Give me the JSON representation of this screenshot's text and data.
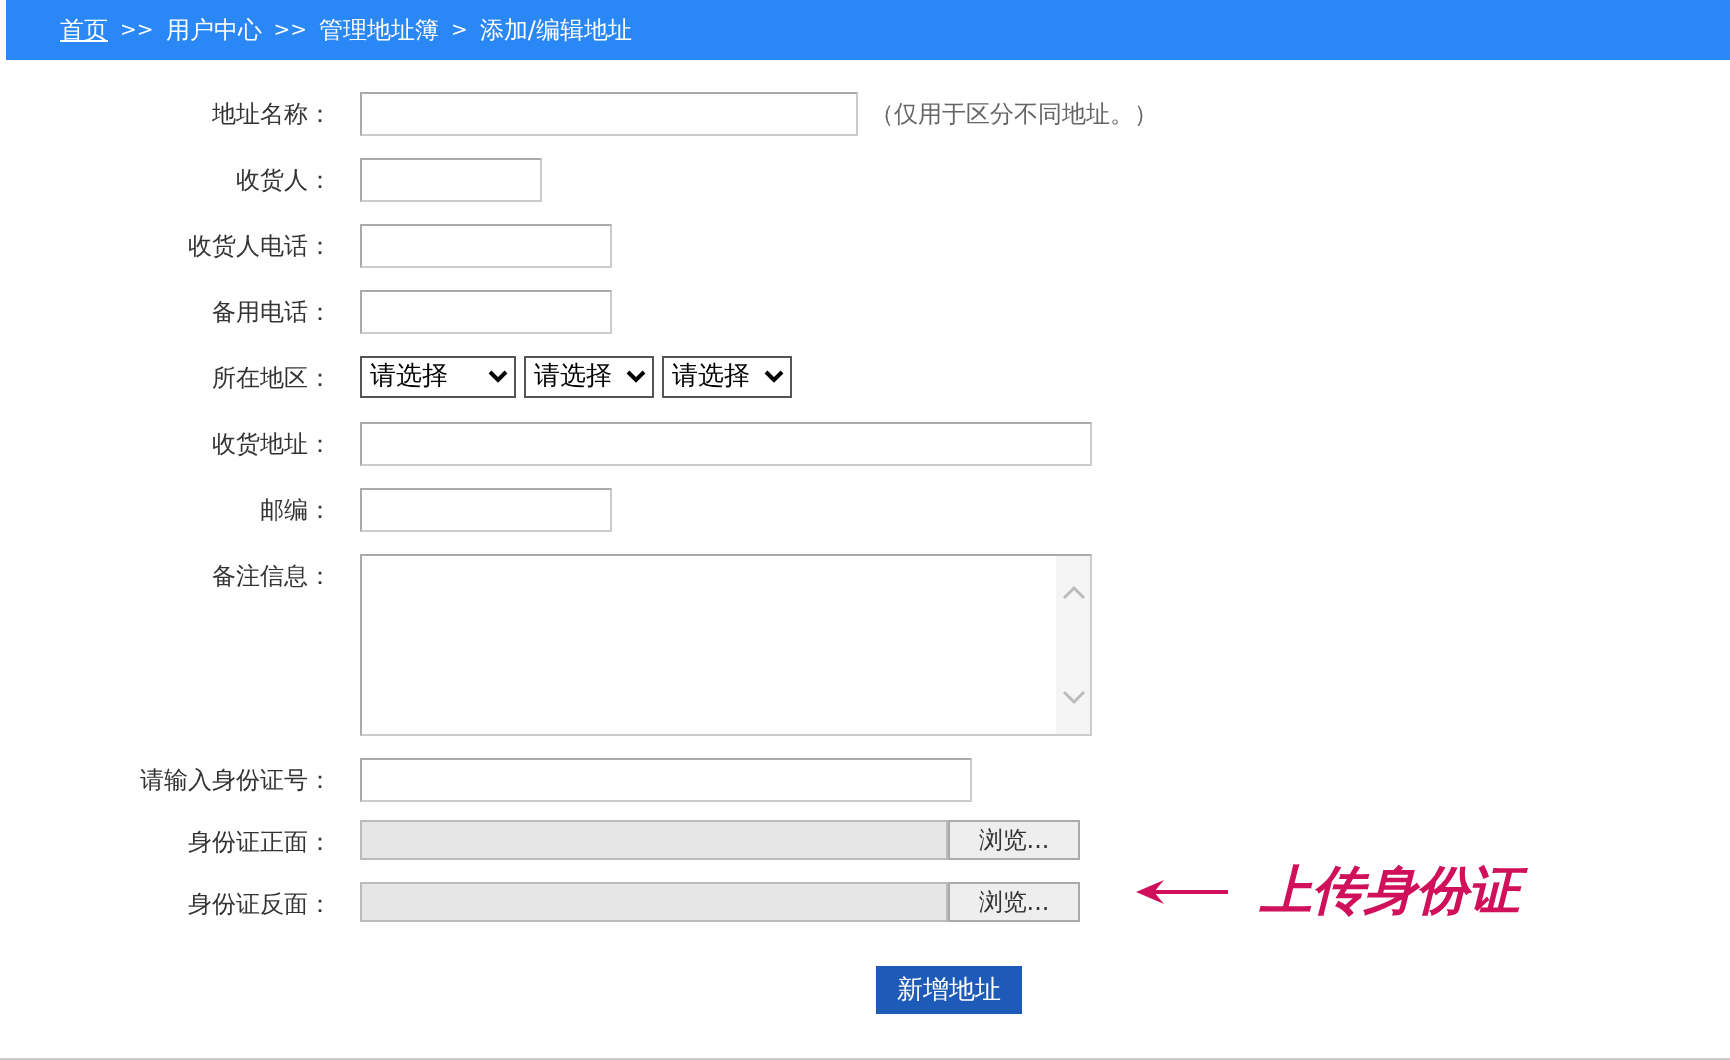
{
  "breadcrumb": [
    {
      "label": "首页",
      "kind": "link"
    },
    {
      "label": ">>",
      "kind": "sep"
    },
    {
      "label": "用户中心",
      "kind": "text"
    },
    {
      "label": ">>",
      "kind": "sep"
    },
    {
      "label": "管理地址簿",
      "kind": "text"
    },
    {
      "label": ">",
      "kind": "sep"
    },
    {
      "label": "添加/编辑地址",
      "kind": "text"
    }
  ],
  "fields": [
    {
      "label": "地址名称：",
      "kind": "text",
      "note": "（仅用于区分不同地址。）"
    },
    {
      "label": "收货人：",
      "kind": "text"
    },
    {
      "label": "收货人电话：",
      "kind": "text"
    },
    {
      "label": "备用电话：",
      "kind": "text"
    },
    {
      "label": "所在地区：",
      "kind": "selects",
      "options": [
        "请选择",
        "请选择",
        "请选择"
      ]
    },
    {
      "label": "收货地址：",
      "kind": "text"
    },
    {
      "label": "邮编：",
      "kind": "text"
    },
    {
      "label": "备注信息：",
      "kind": "textarea"
    },
    {
      "label": "请输入身份证号：",
      "kind": "text"
    },
    {
      "label": "身份证正面：",
      "kind": "file",
      "button": "浏览..."
    },
    {
      "label": "身份证反面：",
      "kind": "file",
      "button": "浏览..."
    }
  ],
  "annotation": {
    "text": "上传身份证"
  },
  "submit": "新增地址"
}
